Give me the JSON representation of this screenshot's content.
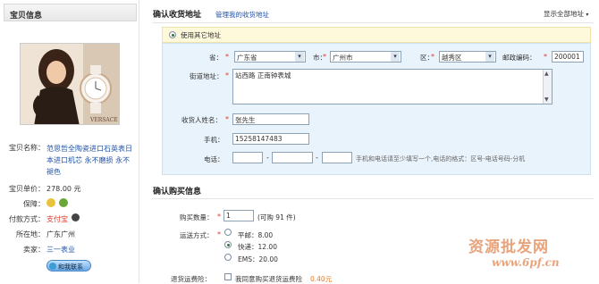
{
  "left": {
    "header": "宝贝信息",
    "photo_brand": "VERSACE",
    "name_label": "宝贝名称：",
    "name_value": "范思哲全陶瓷进口石英表日本进口机芯 永不磨损 永不褪色",
    "price_label": "宝贝单价：",
    "price_value": "278.00 元",
    "guarantee_label": "保障：",
    "payment_label": "付款方式：",
    "payment_value": "支付宝",
    "location_label": "所在地：",
    "location_value": "广东广州",
    "seller_label": "卖家：",
    "seller_value": "三一表业",
    "chat_label": "和我联系"
  },
  "address": {
    "title": "确认收货地址",
    "manage_link": "管理我的收货地址",
    "show_all": "显示全部地址",
    "use_other": "使用其它地址",
    "province_label": "省：",
    "province_value": "广东省",
    "city_label": "市：",
    "city_value": "广州市",
    "district_label": "区：",
    "district_value": "越秀区",
    "postcode_label": "邮政编码：",
    "postcode_value": "200001",
    "street_label": "街道地址：",
    "street_value": "站西路 正南钟表城",
    "name_label": "收货人姓名：",
    "name_value": "张先生",
    "mobile_label": "手机：",
    "mobile_value": "15258147483",
    "phone_label": "电话：",
    "phone_sep1": "-",
    "phone_sep2": "-",
    "phone_hint": "手机和电话请至少填写一个,电话的格式：区号-电话号码-分机",
    "required_mark": "*"
  },
  "purchase": {
    "title": "确认购买信息",
    "qty_label": "购买数量：",
    "qty_value": "1",
    "qty_avail": "(可购 91 件)",
    "ship_label": "运送方式：",
    "ship_options": [
      "平邮：8.00",
      "快递：12.00",
      "EMS：20.00"
    ],
    "return_label": "退货运费险：",
    "return_text": "我同意购买退货运费险",
    "return_price": "0.40元"
  },
  "watermark": {
    "cn": "资源批发网",
    "url": "www.6pf.cn"
  },
  "colors": {
    "link": "#2255aa",
    "required": "#e4392b",
    "form_bg": "#e9f3fb",
    "notice_bg": "#fff9dc"
  }
}
